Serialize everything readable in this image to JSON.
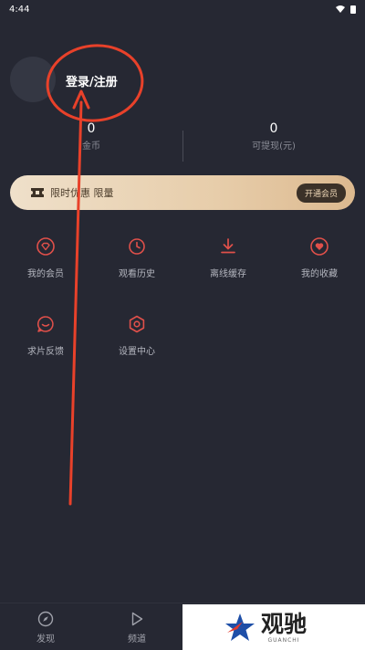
{
  "status_bar": {
    "time": "4:44"
  },
  "profile": {
    "login_label": "登录/注册"
  },
  "stats": [
    {
      "value": "0",
      "label": "金币"
    },
    {
      "value": "0",
      "label": "可提现(元)"
    }
  ],
  "promo": {
    "text": "限时优惠 限量",
    "button": "开通会员"
  },
  "menu": [
    {
      "label": "我的会员",
      "icon": "diamond-icon"
    },
    {
      "label": "观看历史",
      "icon": "clock-icon"
    },
    {
      "label": "离线缓存",
      "icon": "download-icon"
    },
    {
      "label": "我的收藏",
      "icon": "heart-icon"
    },
    {
      "label": "求片反馈",
      "icon": "feedback-icon"
    },
    {
      "label": "设置中心",
      "icon": "settings-icon"
    }
  ],
  "bottom_nav": [
    {
      "label": "发现",
      "icon": "compass-icon"
    },
    {
      "label": "频道",
      "icon": "play-icon"
    }
  ],
  "watermark": {
    "name": "观驰",
    "sub": "GUANCHI"
  },
  "colors": {
    "background": "#262833",
    "accent_red": "#e0504a",
    "promo_gold": "#e7cdaa",
    "annotation_red": "#e8412a"
  }
}
